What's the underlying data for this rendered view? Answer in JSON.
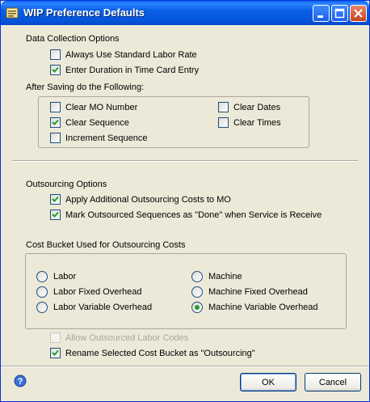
{
  "window": {
    "title": "WIP Preference Defaults"
  },
  "data_collection": {
    "heading": "Data Collection Options",
    "always_std_labor": {
      "label": "Always Use Standard Labor Rate",
      "checked": false
    },
    "enter_duration": {
      "label": "Enter Duration in Time Card Entry",
      "checked": true
    }
  },
  "after_saving": {
    "heading": "After Saving do the Following:",
    "clear_mo": {
      "label": "Clear MO Number",
      "checked": false
    },
    "clear_sequence": {
      "label": "Clear Sequence",
      "checked": true
    },
    "increment_sequence": {
      "label": "Increment Sequence",
      "checked": false
    },
    "clear_dates": {
      "label": "Clear Dates",
      "checked": false
    },
    "clear_times": {
      "label": "Clear Times",
      "checked": false
    }
  },
  "outsourcing": {
    "heading": "Outsourcing Options",
    "apply_costs": {
      "label": "Apply Additional Outsourcing Costs to MO",
      "checked": true
    },
    "mark_done": {
      "label": "Mark Outsourced Sequences as \"Done\" when Service is Receive",
      "checked": true
    }
  },
  "cost_bucket": {
    "heading": "Cost Bucket Used for Outsourcing Costs",
    "labor": "Labor",
    "labor_fixed": "Labor Fixed Overhead",
    "labor_variable": "Labor Variable Overhead",
    "machine": "Machine",
    "machine_fixed": "Machine Fixed Overhead",
    "machine_variable": "Machine Variable Overhead",
    "selected": "Machine Variable Overhead"
  },
  "allow_outsourced": {
    "label": "Allow Outsourced Labor Codes",
    "checked": false,
    "enabled": false
  },
  "rename_bucket": {
    "label": "Rename Selected Cost Bucket as \"Outsourcing\"",
    "checked": true
  },
  "buttons": {
    "ok": "OK",
    "cancel": "Cancel"
  },
  "colors": {
    "titlebar": "#0a5fe6",
    "face": "#ece9d8",
    "check": "#21a121"
  }
}
